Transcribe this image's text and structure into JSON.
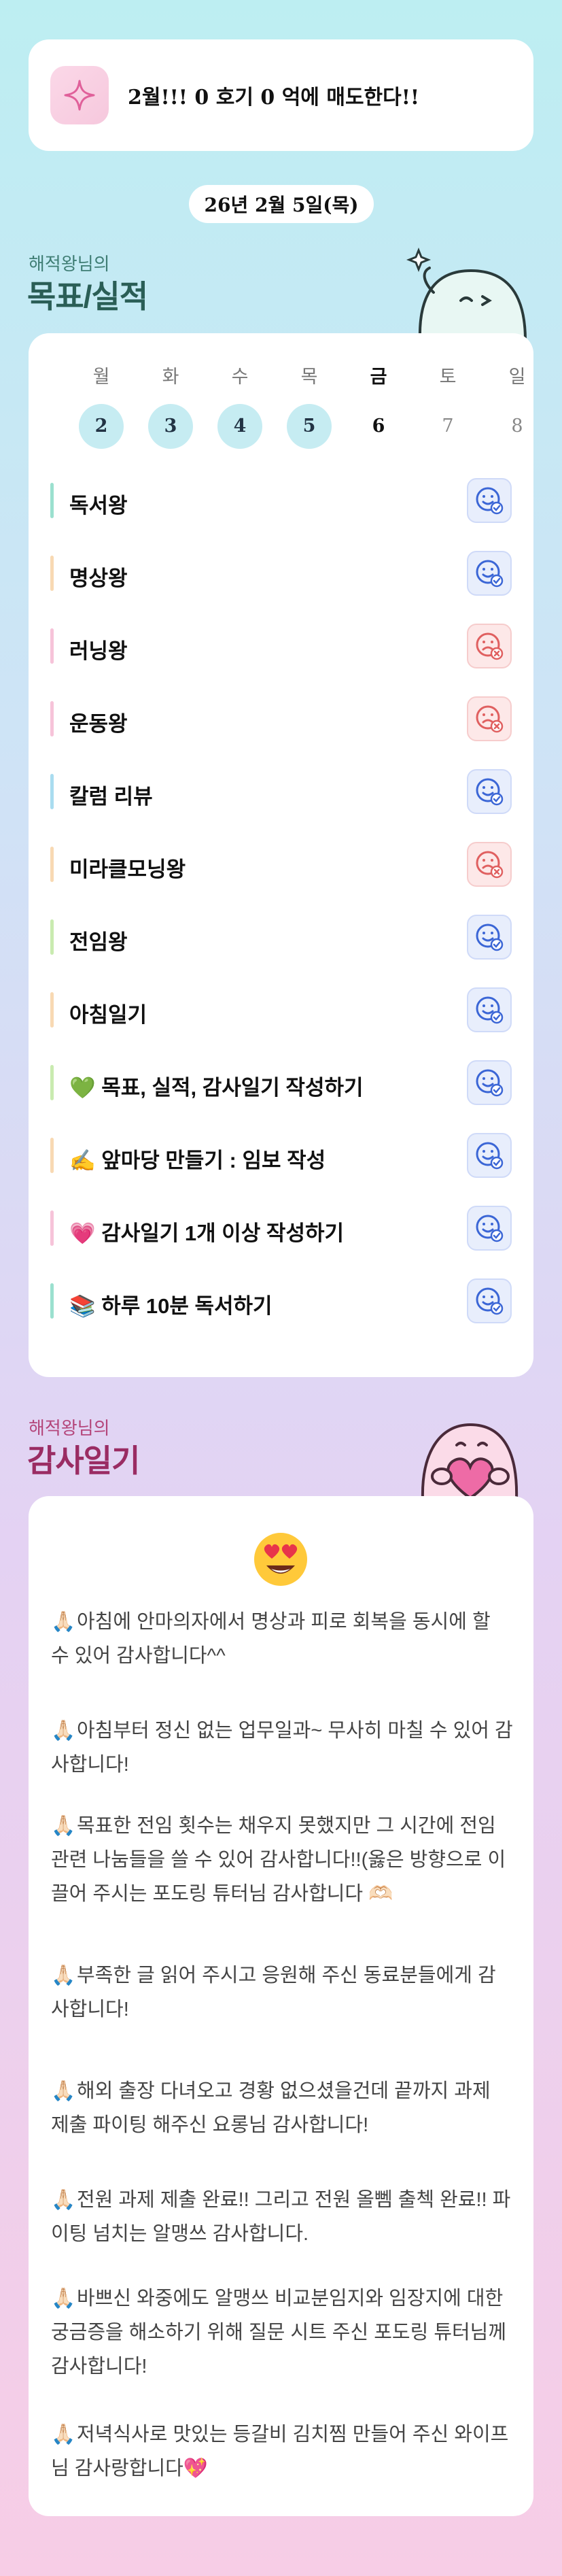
{
  "goal_banner": {
    "icon": "sparkle-icon",
    "text": "2월!!! 0 호기 0 억에 매도한다!!"
  },
  "date": "26년 2월 5일(목)",
  "goals_section": {
    "subtitle": "해적왕님의",
    "title": "목표/실적"
  },
  "week": {
    "days": [
      {
        "label": "월",
        "num": "2",
        "state": "done"
      },
      {
        "label": "화",
        "num": "3",
        "state": "done"
      },
      {
        "label": "수",
        "num": "4",
        "state": "done"
      },
      {
        "label": "목",
        "num": "5",
        "state": "done"
      },
      {
        "label": "금",
        "num": "6",
        "state": "today"
      },
      {
        "label": "토",
        "num": "7",
        "state": "future"
      },
      {
        "label": "일",
        "num": "8",
        "state": "future"
      }
    ]
  },
  "goals": [
    {
      "label": "독서왕",
      "status": "done",
      "bar_color": "#9be0cf"
    },
    {
      "label": "명상왕",
      "status": "done",
      "bar_color": "#f8d9b3"
    },
    {
      "label": "러닝왕",
      "status": "fail",
      "bar_color": "#f6c3d9"
    },
    {
      "label": "운동왕",
      "status": "fail",
      "bar_color": "#f6c3d9"
    },
    {
      "label": "칼럼 리뷰",
      "status": "done",
      "bar_color": "#a9dcf0"
    },
    {
      "label": "미라클모닝왕",
      "status": "fail",
      "bar_color": "#f8d9b3"
    },
    {
      "label": "전임왕",
      "status": "done",
      "bar_color": "#c9ebb0"
    },
    {
      "label": "아침일기",
      "status": "done",
      "bar_color": "#f8d9b3"
    },
    {
      "label": "💚 목표, 실적, 감사일기 작성하기",
      "status": "done",
      "bar_color": "#c9ebb0"
    },
    {
      "label": "✍️ 앞마당 만들기 : 임보 작성",
      "status": "done",
      "bar_color": "#f8d9b3"
    },
    {
      "label": "💗 감사일기 1개 이상 작성하기",
      "status": "done",
      "bar_color": "#f6c3d9"
    },
    {
      "label": "📚 하루 10분 독서하기",
      "status": "done",
      "bar_color": "#9be0cf"
    }
  ],
  "journal_section": {
    "subtitle": "해적왕님의",
    "title": "감사일기"
  },
  "journal": {
    "mood_icon": "heart-eyes-emoji",
    "hand_icon": "🙏🏻",
    "entries": [
      "아침에 안마의자에서 명상과 피로 회복을 동시에 할 수 있어 감사합니다^^",
      "아침부터 정신 없는 업무일과~ 무사히 마칠 수 있어 감사합니다!",
      "목표한 전임 횟수는 채우지 못했지만 그 시간에 전임관련 나눔들을 쓸 수 있어 감사합니다!!(옳은 방향으로 이끌어 주시는 포도링 튜터님 감사합니다 🫶🏻",
      "부족한 글 읽어 주시고 응원해 주신 동료분들에게 감사합니다!",
      "해외 출장 다녀오고 경황 없으셨을건데 끝까지 과제 제출 파이팅 해주신 요롱님 감사합니다!",
      "전원 과제 제출 완료!! 그리고 전원 올뻼 출첵 완료!! 파이팅 넘치는 알맹쓰 감사합니다.",
      "바쁘신 와중에도 알맹쓰 비교분임지와 임장지에 대한 궁금증을 해소하기 위해 질문 시트 주신 포도링 튜터님께 감사합니다!",
      "저녁식사로 맛있는 등갈비 김치찜 만들어 주신 와이프님 감사랑합니다💖"
    ]
  },
  "colors": {
    "done_day_bg": "#c6ecf2",
    "done_icon": "#3b66d6",
    "fail_icon": "#e06060",
    "goals_title": "#2a5e56",
    "journal_title": "#9a2c63"
  }
}
